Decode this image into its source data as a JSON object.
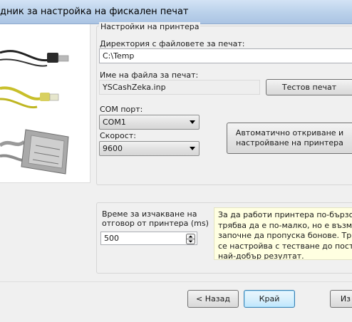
{
  "window": {
    "title": "дник за настройка на фискален печат"
  },
  "printer_settings": {
    "group_title": "Настройки на принтера",
    "directory_label": "Директория с файловете за печат:",
    "directory_value": "C:\\Temp",
    "filename_label": "Име на файла за печат:",
    "filename_value": "YSCashZeka.inp",
    "test_print_button": "Тестов печат",
    "com_port_label": "COM порт:",
    "com_port_value": "COM1",
    "speed_label": "Скорост:",
    "speed_value": "9600",
    "autodetect_button": "Автоматично откриване и настройване на принтера"
  },
  "timeout": {
    "label_line1": "Време за изчакване на",
    "label_line2": "отговор от принтера (ms)",
    "value": "500",
    "info_text": "За да работи принтера по-бързо врем\nтрябва да е по-малко, но е възможно \nзапочне да пропуска бонове. Трябва д\nсе настройва с тестване до постигане\nнай-добър резултат."
  },
  "footer": {
    "back_button": "< Назад",
    "finish_button": "Край",
    "exit_button": "Из"
  },
  "colors": {
    "info_background": "#ffffe1",
    "title_bar": "#b9d0ea",
    "dialog_background": "#f0f0f0"
  },
  "image": {
    "subject": "printer connection cables: USB, network, parallel"
  }
}
